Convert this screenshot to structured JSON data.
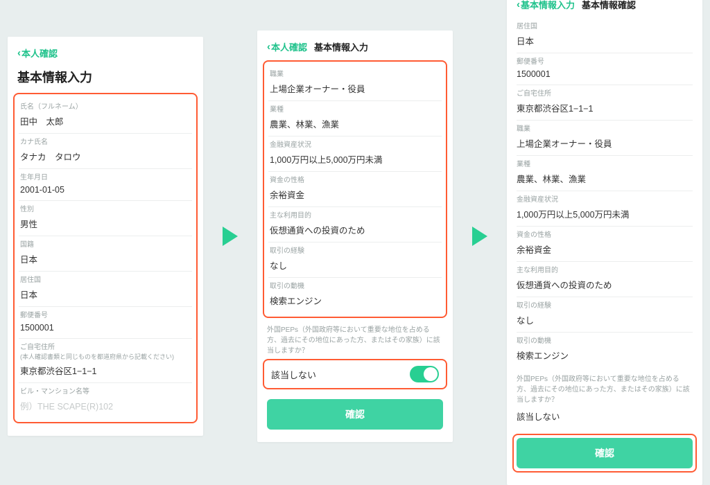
{
  "colors": {
    "accent": "#1fc28b",
    "cta": "#3fd3a3",
    "highlight": "#ff5b33"
  },
  "arrow_glyph": "▶",
  "screen1": {
    "back_label": "本人確認",
    "title": "基本情報入力",
    "fields": [
      {
        "label": "氏名（フルネーム）",
        "value": "田中　太郎"
      },
      {
        "label": "カナ氏名",
        "value": "タナカ　タロウ"
      },
      {
        "label": "生年月日",
        "value": "2001-01-05"
      },
      {
        "label": "性別",
        "value": "男性"
      },
      {
        "label": "国籍",
        "value": "日本"
      },
      {
        "label": "居住国",
        "value": "日本"
      },
      {
        "label": "郵便番号",
        "value": "1500001"
      },
      {
        "label": "ご自宅住所",
        "sublabel": "(本人確認書類と同じものを都道府県から記載ください)",
        "value": "東京都渋谷区1−1−1"
      },
      {
        "label": "ビル・マンション名等",
        "placeholder": "例）THE SCAPE(R)102"
      }
    ]
  },
  "screen2": {
    "back_label": "本人確認",
    "header_title": "基本情報入力",
    "fields": [
      {
        "label": "職業",
        "value": "上場企業オーナー・役員"
      },
      {
        "label": "業種",
        "value": "農業、林業、漁業"
      },
      {
        "label": "金融資産状況",
        "value": "1,000万円以上5,000万円未満"
      },
      {
        "label": "資金の性格",
        "value": "余裕資金"
      },
      {
        "label": "主な利用目的",
        "value": "仮想通貨への投資のため"
      },
      {
        "label": "取引の経験",
        "value": "なし"
      },
      {
        "label": "取引の動機",
        "value": "検索エンジン"
      }
    ],
    "pep_note": "外国PEPs（外国政府等において重要な地位を占める方、過去にその地位にあった方、またはその家族）に該当しますか？",
    "toggle_label": "該当しない",
    "cta_label": "確認"
  },
  "screen3": {
    "back_label": "基本情報入力",
    "header_title": "基本情報確認",
    "fields": [
      {
        "label": "居住国",
        "value": "日本"
      },
      {
        "label": "郵便番号",
        "value": "1500001"
      },
      {
        "label": "ご自宅住所",
        "value": "東京都渋谷区1−1−1"
      },
      {
        "label": "職業",
        "value": "上場企業オーナー・役員"
      },
      {
        "label": "業種",
        "value": "農業、林業、漁業"
      },
      {
        "label": "金融資産状況",
        "value": "1,000万円以上5,000万円未満"
      },
      {
        "label": "資金の性格",
        "value": "余裕資金"
      },
      {
        "label": "主な利用目的",
        "value": "仮想通貨への投資のため"
      },
      {
        "label": "取引の経験",
        "value": "なし"
      },
      {
        "label": "取引の動機",
        "value": "検索エンジン"
      }
    ],
    "pep_note": "外国PEPs（外国政府等において重要な地位を占める方、過去にその地位にあった方、またはその家族）に該当しますか？",
    "pep_value": "該当しない",
    "cta_label": "確認"
  }
}
